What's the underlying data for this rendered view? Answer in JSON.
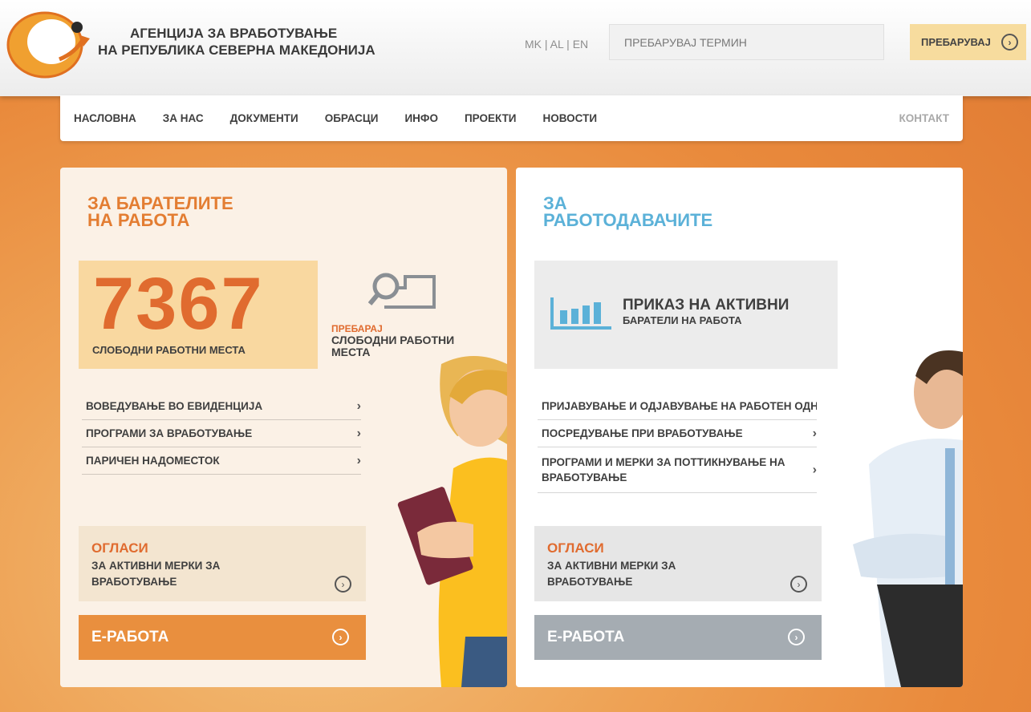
{
  "header": {
    "agency_line1": "АГЕНЦИЈА ЗА ВРАБОТУВАЊЕ",
    "agency_line2": "НА РЕПУБЛИКА СЕВЕРНА МАКЕДОНИЈА",
    "lang": [
      "MK",
      "AL",
      "EN"
    ],
    "lang_sep": "|",
    "search_placeholder": "ПРЕБАРУВАЈ ТЕРМИН",
    "search_button": "ПРЕБАРУВАЈ"
  },
  "nav": {
    "items": [
      "НАСЛОВНА",
      "ЗА НАС",
      "ДОКУМЕНТИ",
      "ОБРАСЦИ",
      "ИНФО",
      "ПРОЕКТИ",
      "НОВОСТИ"
    ],
    "contact": "КОНТАКТ"
  },
  "job_seekers": {
    "title_line1": "ЗА БАРАТЕЛИТЕ",
    "title_line2": "НА РАБОТА",
    "count": "7367",
    "count_label": "СЛОБОДНИ РАБОТНИ МЕСТА",
    "search_label": "ПРЕБАРАЈ",
    "search_line1": "СЛОБОДНИ РАБОТНИ",
    "search_line2": "МЕСТА",
    "links": [
      "ВОВЕДУВАЊЕ ВО ЕВИДЕНЦИЈА",
      "ПРОГРАМИ ЗА ВРАБОТУВАЊЕ",
      "ПАРИЧЕН НАДОМЕСТОК"
    ],
    "ads_title": "ОГЛАСИ",
    "ads_line1": "ЗА АКТИВНИ МЕРКИ ЗА",
    "ads_line2": "ВРАБОТУВАЊЕ",
    "erabota": "Е-РАБОТА"
  },
  "employers": {
    "title_line1": "ЗА",
    "title_line2": "РАБОТОДАВАЧИТЕ",
    "active_line1": "ПРИКАЗ НА АКТИВНИ",
    "active_line2": "БАРАТЕЛИ НА РАБОТА",
    "links": [
      "ПРИЈАВУВАЊЕ И ОДЈАВУВАЊЕ НА РАБОТЕН ОДНОС",
      "ПОСРЕДУВАЊЕ ПРИ ВРАБОТУВАЊЕ",
      "ПРОГРАМИ И МЕРКИ ЗА ПОТТИКНУВАЊЕ НА ВРАБОТУВАЊЕ"
    ],
    "ads_title": "ОГЛАСИ",
    "ads_line1": "ЗА АКТИВНИ МЕРКИ ЗА",
    "ads_line2": "ВРАБОТУВАЊЕ",
    "erabota": "Е-РАБОТА"
  },
  "icons": {
    "chevron": "›",
    "arrow": "›"
  },
  "colors": {
    "accent_orange": "#e37d32",
    "accent_blue": "#5bb1d8",
    "button_yellow": "#f7dc9e",
    "erabota_orange": "#e98f3e",
    "erabota_gray": "#a5acb2"
  }
}
